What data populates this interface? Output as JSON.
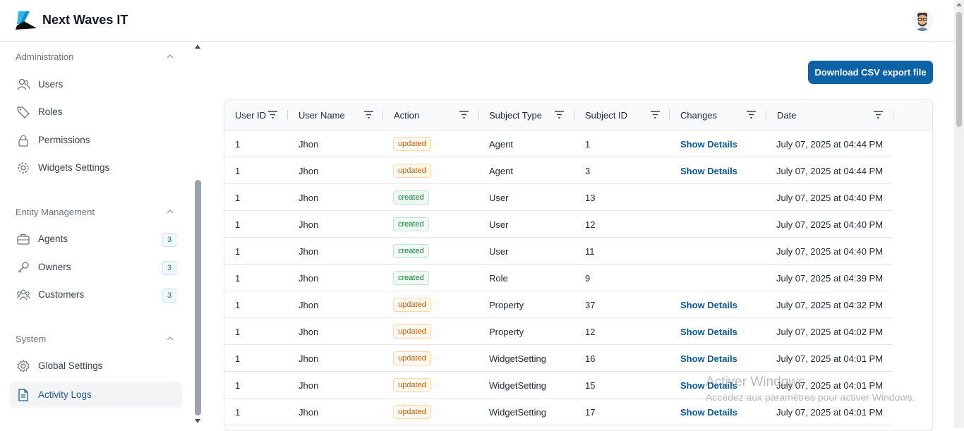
{
  "header": {
    "brand": "Next Waves IT"
  },
  "sidebar": {
    "sections": [
      {
        "title": "Administration",
        "items": [
          {
            "label": "Users",
            "icon": "users-icon"
          },
          {
            "label": "Roles",
            "icon": "tag-icon"
          },
          {
            "label": "Permissions",
            "icon": "lock-icon"
          },
          {
            "label": "Widgets Settings",
            "icon": "gear-icon"
          }
        ]
      },
      {
        "title": "Entity Management",
        "items": [
          {
            "label": "Agents",
            "icon": "briefcase-icon",
            "badge": "3"
          },
          {
            "label": "Owners",
            "icon": "key-icon",
            "badge": "3"
          },
          {
            "label": "Customers",
            "icon": "group-icon",
            "badge": "3"
          }
        ]
      },
      {
        "title": "System",
        "items": [
          {
            "label": "Global Settings",
            "icon": "settings-icon"
          },
          {
            "label": "Activity Logs",
            "icon": "document-icon",
            "active": true
          }
        ]
      }
    ]
  },
  "main": {
    "export_button": "Download CSV export file",
    "columns": [
      "User ID",
      "User Name",
      "Action",
      "Subject Type",
      "Subject ID",
      "Changes",
      "Date"
    ],
    "rows": [
      {
        "user_id": "1",
        "user_name": "Jhon",
        "action": "updated",
        "subject_type": "Agent",
        "subject_id": "1",
        "changes": "Show Details",
        "date": "July 07, 2025 at 04:44 PM"
      },
      {
        "user_id": "1",
        "user_name": "Jhon",
        "action": "updated",
        "subject_type": "Agent",
        "subject_id": "3",
        "changes": "Show Details",
        "date": "July 07, 2025 at 04:44 PM"
      },
      {
        "user_id": "1",
        "user_name": "Jhon",
        "action": "created",
        "subject_type": "User",
        "subject_id": "13",
        "changes": "",
        "date": "July 07, 2025 at 04:40 PM"
      },
      {
        "user_id": "1",
        "user_name": "Jhon",
        "action": "created",
        "subject_type": "User",
        "subject_id": "12",
        "changes": "",
        "date": "July 07, 2025 at 04:40 PM"
      },
      {
        "user_id": "1",
        "user_name": "Jhon",
        "action": "created",
        "subject_type": "User",
        "subject_id": "11",
        "changes": "",
        "date": "July 07, 2025 at 04:40 PM"
      },
      {
        "user_id": "1",
        "user_name": "Jhon",
        "action": "created",
        "subject_type": "Role",
        "subject_id": "9",
        "changes": "",
        "date": "July 07, 2025 at 04:39 PM"
      },
      {
        "user_id": "1",
        "user_name": "Jhon",
        "action": "updated",
        "subject_type": "Property",
        "subject_id": "37",
        "changes": "Show Details",
        "date": "July 07, 2025 at 04:32 PM"
      },
      {
        "user_id": "1",
        "user_name": "Jhon",
        "action": "updated",
        "subject_type": "Property",
        "subject_id": "12",
        "changes": "Show Details",
        "date": "July 07, 2025 at 04:02 PM"
      },
      {
        "user_id": "1",
        "user_name": "Jhon",
        "action": "updated",
        "subject_type": "WidgetSetting",
        "subject_id": "16",
        "changes": "Show Details",
        "date": "July 07, 2025 at 04:01 PM"
      },
      {
        "user_id": "1",
        "user_name": "Jhon",
        "action": "updated",
        "subject_type": "WidgetSetting",
        "subject_id": "15",
        "changes": "Show Details",
        "date": "July 07, 2025 at 04:01 PM"
      },
      {
        "user_id": "1",
        "user_name": "Jhon",
        "action": "updated",
        "subject_type": "WidgetSetting",
        "subject_id": "17",
        "changes": "Show Details",
        "date": "July 07, 2025 at 04:01 PM"
      }
    ]
  },
  "watermark": {
    "line1": "Activer Windows",
    "line2": "Accédez aux paramètres pour activer Windows."
  },
  "colors": {
    "primary": "#0b63a5",
    "updated": "#c2610c",
    "created": "#15803d",
    "link": "#0b5a94"
  }
}
